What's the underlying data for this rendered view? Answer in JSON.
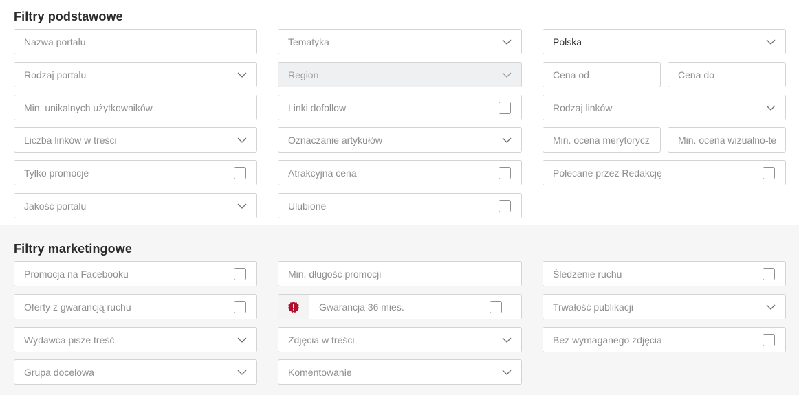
{
  "basic": {
    "title": "Filtry podstawowe",
    "portal_name": "Nazwa portalu",
    "topic": "Tematyka",
    "country": "Polska",
    "portal_type": "Rodzaj portalu",
    "region": "Region",
    "price_from": "Cena od",
    "price_to": "Cena do",
    "min_unique_users": "Min. unikalnych użytkowników",
    "dofollow_links": "Linki dofollow",
    "link_type": "Rodzaj linków",
    "links_in_content": "Liczba linków w treści",
    "article_marking": "Oznaczanie artykułów",
    "min_merit_rating": "Min. ocena merytoryczna",
    "min_visual_rating": "Min. ocena wizualno-techniczna",
    "promotions_only": "Tylko promocje",
    "attractive_price": "Atrakcyjna cena",
    "editors_choice": "Polecane przez Redakcję",
    "portal_quality": "Jakość portalu",
    "favorites": "Ulubione"
  },
  "marketing": {
    "title": "Filtry marketingowe",
    "facebook_promo": "Promocja na Facebooku",
    "min_promo_length": "Min. długość promocji",
    "traffic_tracking": "Śledzenie ruchu",
    "traffic_guarantee": "Oferty z gwarancją ruchu",
    "guarantee_36": "Gwarancja 36 mies.",
    "publication_durability": "Trwałość publikacji",
    "publisher_writes": "Wydawca pisze treść",
    "images_in_content": "Zdjęcia w treści",
    "no_required_image": "Bez wymaganego zdjęcia",
    "target_group": "Grupa docelowa",
    "comments": "Komentowanie"
  },
  "icons": {
    "chevron": "chevron-down-icon",
    "badge": "alert-badge-icon"
  },
  "colors": {
    "badge": "#b0102c",
    "border": "#d3d3d3",
    "placeholder": "#8e8e8e"
  }
}
